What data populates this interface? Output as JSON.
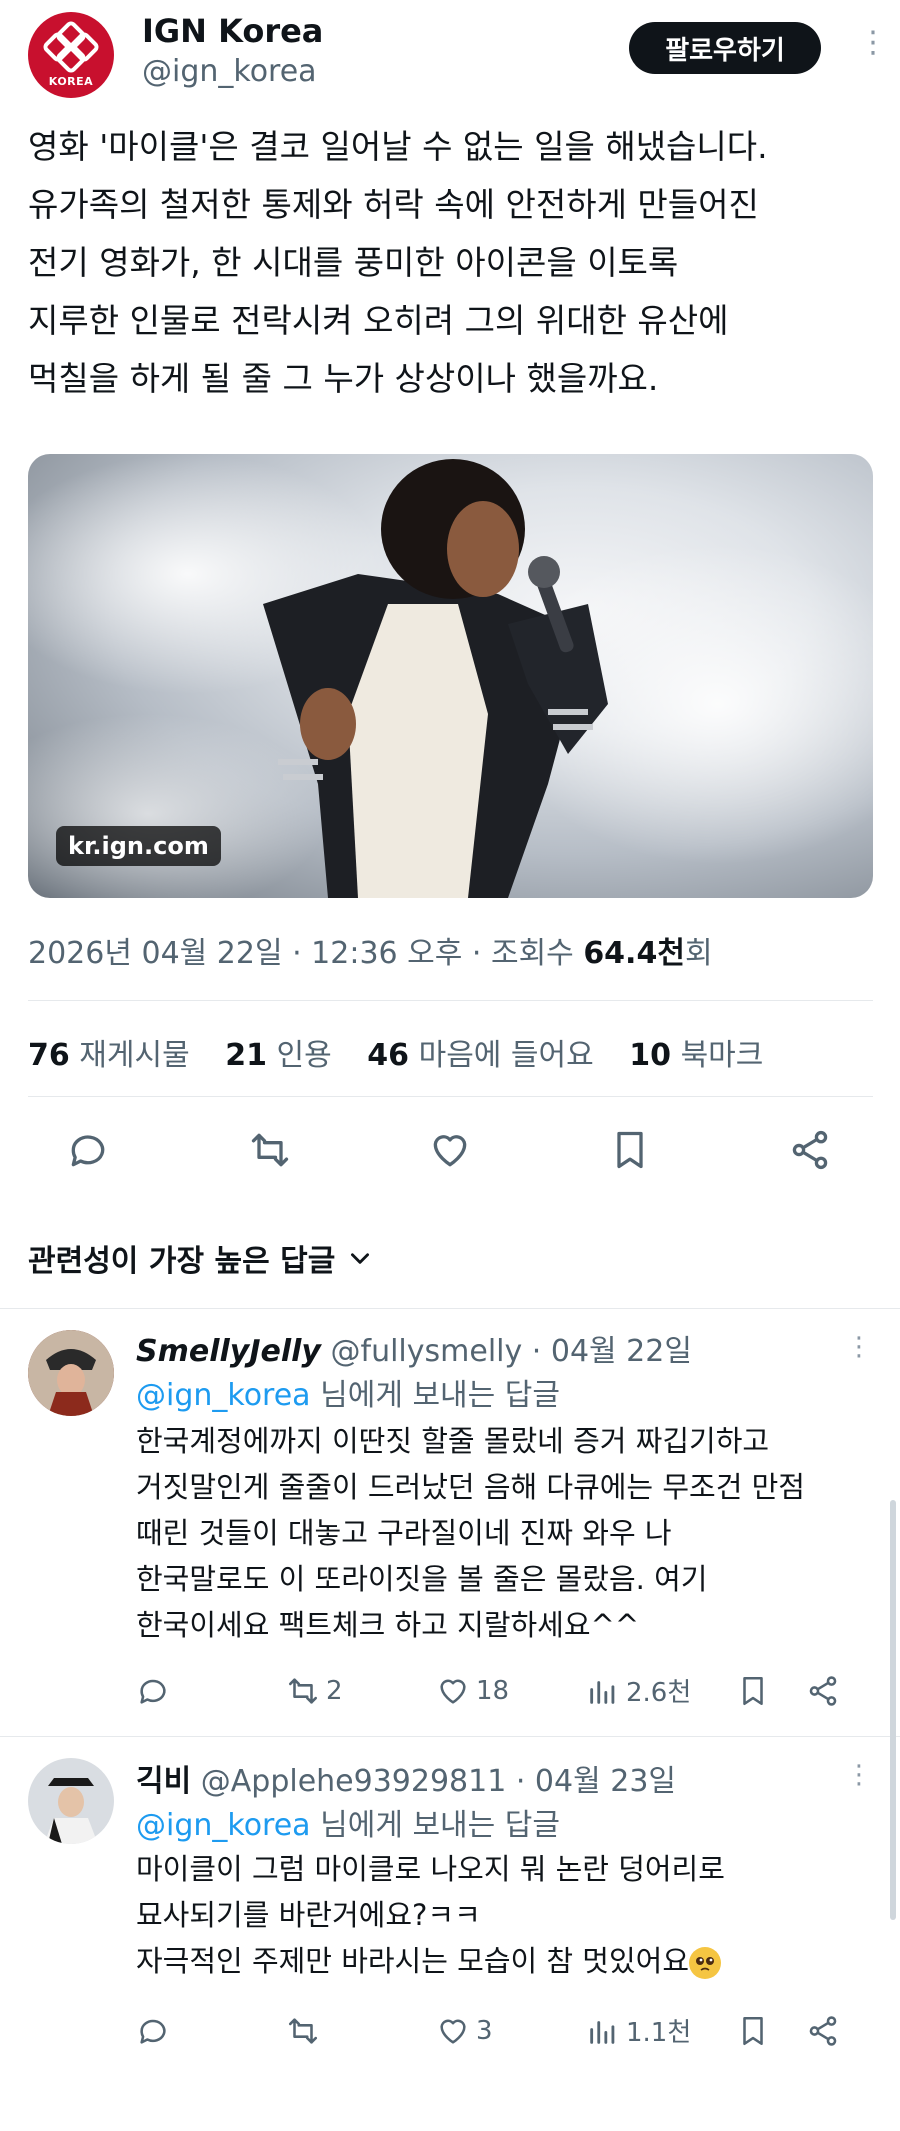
{
  "post": {
    "author_name": "IGN Korea",
    "author_handle": "@ign_korea",
    "avatar_label": "KOREA",
    "follow_label": "팔로우하기",
    "text": "영화 '마이클'은 결코 일어날 수 없는 일을 해냈습니다.\n유가족의 철저한 통제와 허락 속에 안전하게 만들어진\n전기 영화가, 한 시대를 풍미한 아이콘을 이토록\n지루한 인물로 전락시켜 오히려 그의 위대한 유산에\n먹칠을 하게 될 줄 그 누가 상상이나 했을까요.",
    "media_badge": "kr.ign.com",
    "timestamp": "2026년 04월 22일 · 12:36 오후 · 조회수 ",
    "views_value": "64.4천",
    "views_suffix": "회"
  },
  "stats": [
    {
      "value": "76",
      "label": "재게시물"
    },
    {
      "value": "21",
      "label": "인용"
    },
    {
      "value": "46",
      "label": "마음에 들어요"
    },
    {
      "value": "10",
      "label": "북마크"
    }
  ],
  "actions": [
    "reply-icon",
    "repost-icon",
    "like-icon",
    "bookmark-icon",
    "share-icon"
  ],
  "sort_label": "관련성이 가장 높은 답글",
  "replies": [
    {
      "name": "SmellyJelly",
      "handle": "@fullysmelly",
      "date": " · 04월 22일",
      "to_mention": "@ign_korea",
      "to_suffix": " 님에게 보내는 답글",
      "text": "한국계정에까지 이딴짓 할줄 몰랐네 증거 짜깁기하고\n거짓말인게 줄줄이 드러났던 음해 다큐에는 무조건 만점\n때린 것들이 대놓고 구라질이네 진짜 와우 나\n한국말로도 이 또라이짓을 볼 줄은 몰랐음. 여기\n한국이세요 팩트체크 하고 지랄하세요^^",
      "reposts": "2",
      "likes": "18",
      "views": "2.6천"
    },
    {
      "name": "긱비",
      "handle": "@Applehe93929811",
      "date": " · 04월 23일",
      "to_mention": "@ign_korea",
      "to_suffix": " 님에게 보내는 답글",
      "text": "마이클이 그럼 마이클로 나오지 뭐 논란 덩어리로\n묘사되기를 바란거에요?ㅋㅋ\n자극적인 주제만 바라시는 모습이 참 멋있어요",
      "reposts": "",
      "likes": "3",
      "views": "1.1천"
    }
  ],
  "colors": {
    "accent": "#1d9bf0",
    "brand": "#c8102e",
    "text": "#0f1419",
    "muted": "#536471"
  }
}
